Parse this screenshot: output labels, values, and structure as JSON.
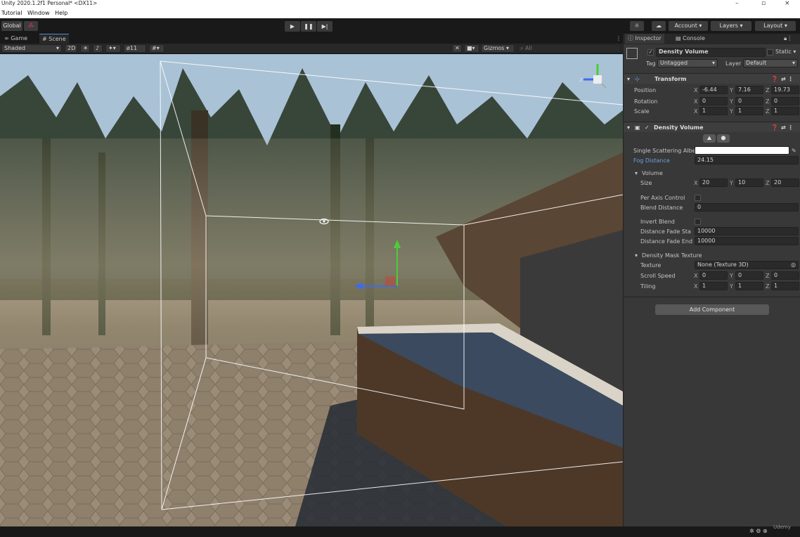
{
  "window": {
    "title": "Unity 2020.1.2f1 Personal* <DX11>",
    "minimize": "–",
    "maximize": "▫",
    "close": "×"
  },
  "menu": [
    "Tutorial",
    "Window",
    "Help"
  ],
  "toolbar": {
    "global": "Global",
    "account": "Account ▾",
    "layers": "Layers ▾",
    "layout": "Layout ▾"
  },
  "scene_tabs": {
    "game": "Game",
    "scene": "Scene"
  },
  "scene_tools": {
    "shading": "Shaded",
    "dim": "2D",
    "layers_count": "11",
    "gizmos": "Gizmos",
    "search_placeholder": "All"
  },
  "inspector": {
    "tab": "Inspector",
    "console_tab": "Console",
    "object_name": "Density Volume",
    "static_label": "Static",
    "tag_label": "Tag",
    "tag_value": "Untagged",
    "layer_label": "Layer",
    "layer_value": "Default",
    "transform": {
      "title": "Transform",
      "position": {
        "label": "Position",
        "x": "-6.44",
        "y": "7.16",
        "z": "19.73"
      },
      "rotation": {
        "label": "Rotation",
        "x": "0",
        "y": "0",
        "z": "0"
      },
      "scale": {
        "label": "Scale",
        "x": "1",
        "y": "1",
        "z": "1"
      }
    },
    "density": {
      "title": "Density Volume",
      "albedo_label": "Single Scattering Albe",
      "fog_label": "Fog Distance",
      "fog_value": "24.15",
      "volume_title": "Volume",
      "size_label": "Size",
      "size_x": "20",
      "size_y": "10",
      "size_z": "20",
      "per_axis_label": "Per Axis Control",
      "blend_label": "Blend Distance",
      "blend_value": "0",
      "invert_label": "Invert Blend",
      "fade_start_label": "Distance Fade Sta",
      "fade_start_value": "10000",
      "fade_end_label": "Distance Fade End",
      "fade_end_value": "10000",
      "mask_title": "Density Mask Texture",
      "texture_label": "Texture",
      "texture_value": "None (Texture 3D)",
      "scroll_label": "Scroll Speed",
      "scroll_x": "0",
      "scroll_y": "0",
      "scroll_z": "0",
      "tiling_label": "Tiling",
      "tiling_x": "1",
      "tiling_y": "1",
      "tiling_z": "1"
    },
    "add_component": "Add Component"
  },
  "axis": {
    "x": "X",
    "y": "Y",
    "z": "Z"
  },
  "watermark": "Udemy",
  "colors": {
    "accent_blue": "#4c8ad6",
    "selection_label": "#6f9fe0"
  }
}
